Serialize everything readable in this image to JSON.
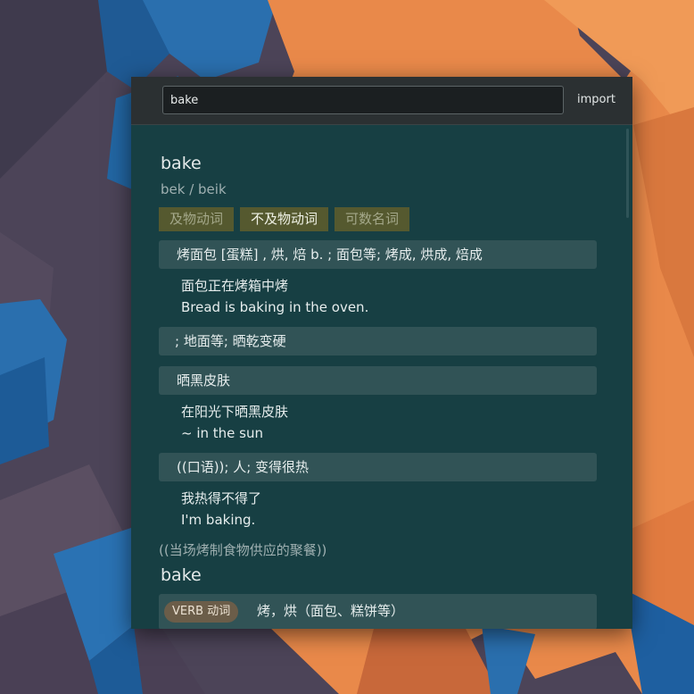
{
  "search": {
    "value": "bake"
  },
  "toolbar": {
    "import_label": "import"
  },
  "entry": {
    "word": "bake",
    "phonetic": "bek / beik",
    "tags": [
      "及物动词",
      "不及物动词",
      "可数名词"
    ],
    "senses": [
      {
        "definition": "烤面包 [蛋糕] , 烘, 焙 b. ; 面包等; 烤成, 烘成, 焙成",
        "example_zh": "面包正在烤箱中烤",
        "example_en": "Bread is baking in the oven."
      },
      {
        "definition": "; 地面等; 晒乾变硬"
      },
      {
        "definition": "晒黑皮肤",
        "example_zh": "在阳光下晒黑皮肤",
        "example_en": "~ in the sun"
      },
      {
        "definition": "((口语)); 人; 变得很热",
        "example_zh": "我热得不得了",
        "example_en": "I'm baking."
      }
    ],
    "noun_note": "((当场烤制食物供应的聚餐))"
  },
  "entry2": {
    "word": "bake",
    "pos_badge": "VERB 动词",
    "definition": "烤，烘（面包、糕饼等）"
  },
  "colors": {
    "panel_bg": "#173f43",
    "toolbar_bg": "#2b3032",
    "sense_bg": "#315356",
    "tag_bg": "#55592f",
    "badge_bg": "#6b5d49",
    "wallpaper_orange": "#e98a45",
    "wallpaper_blue": "#2a6fae"
  }
}
